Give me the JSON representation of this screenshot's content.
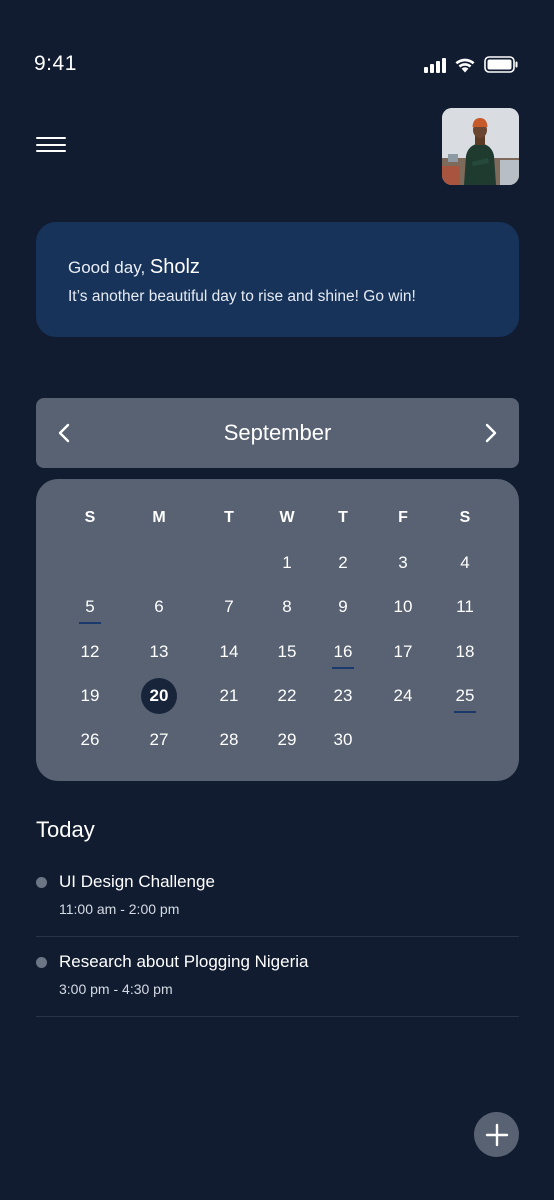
{
  "status_bar": {
    "time": "9:41",
    "icons": [
      "signal-icon",
      "wifi-icon",
      "battery-icon"
    ]
  },
  "header": {
    "menu_icon": "hamburger-menu-icon",
    "avatar_alt": "profile-photo"
  },
  "greeting": {
    "prefix": "Good day, ",
    "name": "Sholz",
    "message": "It’s another beautiful day to rise and shine! Go win!"
  },
  "calendar": {
    "month": "September",
    "prev_icon": "chevron-left-icon",
    "next_icon": "chevron-right-icon",
    "weekdays": [
      "S",
      "M",
      "T",
      "W",
      "T",
      "F",
      "S"
    ],
    "weeks": [
      [
        "",
        "",
        "",
        "1",
        "2",
        "3",
        "4"
      ],
      [
        "5",
        "6",
        "7",
        "8",
        "9",
        "10",
        "11"
      ],
      [
        "12",
        "13",
        "14",
        "15",
        "16",
        "17",
        "18"
      ],
      [
        "19",
        "20",
        "21",
        "22",
        "23",
        "24",
        "25"
      ],
      [
        "26",
        "27",
        "28",
        "29",
        "30",
        "",
        ""
      ]
    ],
    "selected_day": "20",
    "marked_days": [
      "5",
      "16",
      "25"
    ]
  },
  "today": {
    "title": "Today",
    "events": [
      {
        "title": "UI Design Challenge",
        "time": "11:00 am - 2:00 pm"
      },
      {
        "title": "Research about Plogging Nigeria",
        "time": "3:00 pm - 4:30 pm"
      }
    ]
  },
  "fab": {
    "icon": "plus-icon"
  },
  "colors": {
    "background": "#111c31",
    "greeting_card": "#17335a",
    "calendar_panel": "#586272",
    "selected_day": "#18243a",
    "marker": "#1a3a6b"
  }
}
